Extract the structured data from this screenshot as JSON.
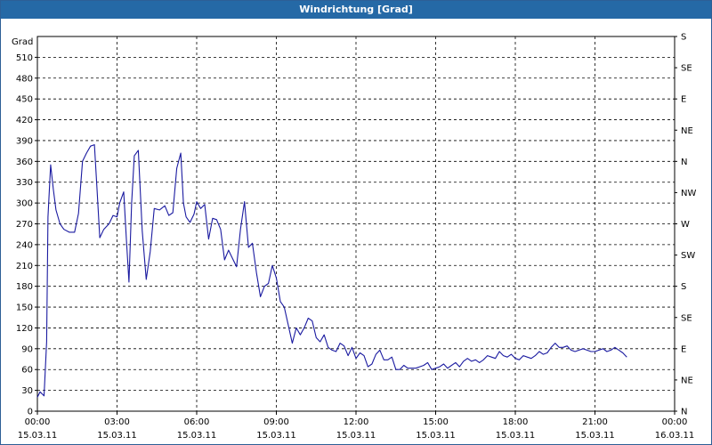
{
  "window": {
    "title": "Windrichtung [Grad]"
  },
  "chart_data": {
    "type": "line",
    "title": "Windrichtung [Grad]",
    "ylabel": "Grad",
    "xlabel": "",
    "ylim": [
      0,
      540
    ],
    "y_ticks": [
      0,
      30,
      60,
      90,
      120,
      150,
      180,
      210,
      240,
      270,
      300,
      330,
      360,
      390,
      420,
      450,
      480,
      510
    ],
    "right_axis_labels": [
      "N",
      "NE",
      "E",
      "SE",
      "S",
      "SW",
      "W",
      "NW",
      "N",
      "NE",
      "E",
      "SE",
      "S"
    ],
    "x_ticks": [
      {
        "hour": 0,
        "time": "00:00",
        "date": "15.03.11"
      },
      {
        "hour": 3,
        "time": "03:00",
        "date": "15.03.11"
      },
      {
        "hour": 6,
        "time": "06:00",
        "date": "15.03.11"
      },
      {
        "hour": 9,
        "time": "09:00",
        "date": "15.03.11"
      },
      {
        "hour": 12,
        "time": "12:00",
        "date": "15.03.11"
      },
      {
        "hour": 15,
        "time": "15:00",
        "date": "15.03.11"
      },
      {
        "hour": 18,
        "time": "18:00",
        "date": "15.03.11"
      },
      {
        "hour": 21,
        "time": "21:00",
        "date": "15.03.11"
      },
      {
        "hour": 24,
        "time": "00:00",
        "date": "16.03.11"
      }
    ],
    "grid": true,
    "color": "#1a1aa0",
    "series": [
      {
        "points": [
          [
            0.0,
            20
          ],
          [
            0.1,
            28
          ],
          [
            0.25,
            22
          ],
          [
            0.35,
            100
          ],
          [
            0.4,
            280
          ],
          [
            0.5,
            355
          ],
          [
            0.6,
            320
          ],
          [
            0.7,
            290
          ],
          [
            0.85,
            270
          ],
          [
            1.0,
            262
          ],
          [
            1.2,
            258
          ],
          [
            1.4,
            258
          ],
          [
            1.55,
            285
          ],
          [
            1.7,
            360
          ],
          [
            1.85,
            372
          ],
          [
            2.0,
            382
          ],
          [
            2.15,
            384
          ],
          [
            2.25,
            318
          ],
          [
            2.35,
            250
          ],
          [
            2.5,
            262
          ],
          [
            2.7,
            270
          ],
          [
            2.85,
            282
          ],
          [
            3.0,
            280
          ],
          [
            3.1,
            300
          ],
          [
            3.25,
            316
          ],
          [
            3.35,
            250
          ],
          [
            3.45,
            186
          ],
          [
            3.55,
            300
          ],
          [
            3.65,
            368
          ],
          [
            3.8,
            376
          ],
          [
            3.95,
            260
          ],
          [
            4.1,
            190
          ],
          [
            4.25,
            230
          ],
          [
            4.4,
            292
          ],
          [
            4.6,
            290
          ],
          [
            4.8,
            296
          ],
          [
            4.95,
            282
          ],
          [
            5.1,
            286
          ],
          [
            5.25,
            350
          ],
          [
            5.4,
            372
          ],
          [
            5.5,
            300
          ],
          [
            5.6,
            280
          ],
          [
            5.75,
            272
          ],
          [
            5.9,
            284
          ],
          [
            6.0,
            302
          ],
          [
            6.15,
            292
          ],
          [
            6.3,
            298
          ],
          [
            6.45,
            248
          ],
          [
            6.6,
            278
          ],
          [
            6.75,
            276
          ],
          [
            6.9,
            262
          ],
          [
            7.05,
            218
          ],
          [
            7.2,
            232
          ],
          [
            7.35,
            220
          ],
          [
            7.5,
            208
          ],
          [
            7.65,
            262
          ],
          [
            7.8,
            302
          ],
          [
            7.95,
            236
          ],
          [
            8.1,
            242
          ],
          [
            8.25,
            200
          ],
          [
            8.4,
            165
          ],
          [
            8.55,
            180
          ],
          [
            8.7,
            184
          ],
          [
            8.85,
            210
          ],
          [
            9.0,
            192
          ],
          [
            9.15,
            158
          ],
          [
            9.3,
            150
          ],
          [
            9.45,
            124
          ],
          [
            9.6,
            98
          ],
          [
            9.75,
            120
          ],
          [
            9.9,
            110
          ],
          [
            10.05,
            120
          ],
          [
            10.2,
            134
          ],
          [
            10.35,
            130
          ],
          [
            10.5,
            106
          ],
          [
            10.65,
            100
          ],
          [
            10.8,
            110
          ],
          [
            10.95,
            92
          ],
          [
            11.1,
            88
          ],
          [
            11.25,
            86
          ],
          [
            11.4,
            98
          ],
          [
            11.55,
            94
          ],
          [
            11.7,
            80
          ],
          [
            11.85,
            92
          ],
          [
            12.0,
            76
          ],
          [
            12.15,
            84
          ],
          [
            12.3,
            80
          ],
          [
            12.45,
            64
          ],
          [
            12.6,
            68
          ],
          [
            12.75,
            82
          ],
          [
            12.9,
            88
          ],
          [
            13.05,
            74
          ],
          [
            13.2,
            74
          ],
          [
            13.35,
            78
          ],
          [
            13.5,
            60
          ],
          [
            13.65,
            60
          ],
          [
            13.8,
            66
          ],
          [
            13.95,
            62
          ],
          [
            14.1,
            62
          ],
          [
            14.25,
            62
          ],
          [
            14.4,
            64
          ],
          [
            14.55,
            66
          ],
          [
            14.7,
            70
          ],
          [
            14.85,
            60
          ],
          [
            15.0,
            62
          ],
          [
            15.15,
            64
          ],
          [
            15.3,
            68
          ],
          [
            15.45,
            62
          ],
          [
            15.6,
            66
          ],
          [
            15.75,
            70
          ],
          [
            15.9,
            64
          ],
          [
            16.05,
            72
          ],
          [
            16.2,
            76
          ],
          [
            16.35,
            72
          ],
          [
            16.5,
            74
          ],
          [
            16.65,
            70
          ],
          [
            16.8,
            74
          ],
          [
            16.95,
            80
          ],
          [
            17.1,
            78
          ],
          [
            17.25,
            76
          ],
          [
            17.4,
            86
          ],
          [
            17.55,
            80
          ],
          [
            17.7,
            78
          ],
          [
            17.85,
            82
          ],
          [
            18.0,
            76
          ],
          [
            18.15,
            74
          ],
          [
            18.3,
            80
          ],
          [
            18.45,
            78
          ],
          [
            18.6,
            76
          ],
          [
            18.75,
            80
          ],
          [
            18.9,
            86
          ],
          [
            19.05,
            82
          ],
          [
            19.2,
            84
          ],
          [
            19.35,
            92
          ],
          [
            19.5,
            98
          ],
          [
            19.65,
            92
          ],
          [
            19.8,
            92
          ],
          [
            19.95,
            94
          ],
          [
            20.1,
            88
          ],
          [
            20.25,
            86
          ],
          [
            20.4,
            88
          ],
          [
            20.55,
            90
          ],
          [
            20.7,
            88
          ],
          [
            20.85,
            86
          ],
          [
            21.0,
            86
          ],
          [
            21.15,
            88
          ],
          [
            21.3,
            90
          ],
          [
            21.45,
            86
          ],
          [
            21.6,
            88
          ],
          [
            21.75,
            92
          ],
          [
            21.9,
            88
          ],
          [
            22.05,
            84
          ],
          [
            22.2,
            78
          ]
        ]
      }
    ]
  }
}
